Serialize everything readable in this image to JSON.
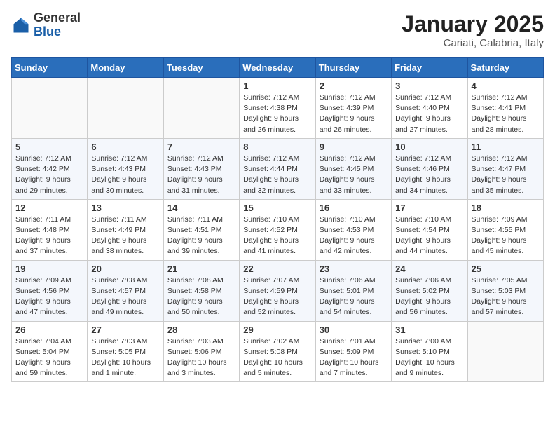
{
  "header": {
    "logo_general": "General",
    "logo_blue": "Blue",
    "month_year": "January 2025",
    "location": "Cariati, Calabria, Italy"
  },
  "weekdays": [
    "Sunday",
    "Monday",
    "Tuesday",
    "Wednesday",
    "Thursday",
    "Friday",
    "Saturday"
  ],
  "weeks": [
    [
      {
        "day": "",
        "info": ""
      },
      {
        "day": "",
        "info": ""
      },
      {
        "day": "",
        "info": ""
      },
      {
        "day": "1",
        "info": "Sunrise: 7:12 AM\nSunset: 4:38 PM\nDaylight: 9 hours and 26 minutes."
      },
      {
        "day": "2",
        "info": "Sunrise: 7:12 AM\nSunset: 4:39 PM\nDaylight: 9 hours and 26 minutes."
      },
      {
        "day": "3",
        "info": "Sunrise: 7:12 AM\nSunset: 4:40 PM\nDaylight: 9 hours and 27 minutes."
      },
      {
        "day": "4",
        "info": "Sunrise: 7:12 AM\nSunset: 4:41 PM\nDaylight: 9 hours and 28 minutes."
      }
    ],
    [
      {
        "day": "5",
        "info": "Sunrise: 7:12 AM\nSunset: 4:42 PM\nDaylight: 9 hours and 29 minutes."
      },
      {
        "day": "6",
        "info": "Sunrise: 7:12 AM\nSunset: 4:43 PM\nDaylight: 9 hours and 30 minutes."
      },
      {
        "day": "7",
        "info": "Sunrise: 7:12 AM\nSunset: 4:43 PM\nDaylight: 9 hours and 31 minutes."
      },
      {
        "day": "8",
        "info": "Sunrise: 7:12 AM\nSunset: 4:44 PM\nDaylight: 9 hours and 32 minutes."
      },
      {
        "day": "9",
        "info": "Sunrise: 7:12 AM\nSunset: 4:45 PM\nDaylight: 9 hours and 33 minutes."
      },
      {
        "day": "10",
        "info": "Sunrise: 7:12 AM\nSunset: 4:46 PM\nDaylight: 9 hours and 34 minutes."
      },
      {
        "day": "11",
        "info": "Sunrise: 7:12 AM\nSunset: 4:47 PM\nDaylight: 9 hours and 35 minutes."
      }
    ],
    [
      {
        "day": "12",
        "info": "Sunrise: 7:11 AM\nSunset: 4:48 PM\nDaylight: 9 hours and 37 minutes."
      },
      {
        "day": "13",
        "info": "Sunrise: 7:11 AM\nSunset: 4:49 PM\nDaylight: 9 hours and 38 minutes."
      },
      {
        "day": "14",
        "info": "Sunrise: 7:11 AM\nSunset: 4:51 PM\nDaylight: 9 hours and 39 minutes."
      },
      {
        "day": "15",
        "info": "Sunrise: 7:10 AM\nSunset: 4:52 PM\nDaylight: 9 hours and 41 minutes."
      },
      {
        "day": "16",
        "info": "Sunrise: 7:10 AM\nSunset: 4:53 PM\nDaylight: 9 hours and 42 minutes."
      },
      {
        "day": "17",
        "info": "Sunrise: 7:10 AM\nSunset: 4:54 PM\nDaylight: 9 hours and 44 minutes."
      },
      {
        "day": "18",
        "info": "Sunrise: 7:09 AM\nSunset: 4:55 PM\nDaylight: 9 hours and 45 minutes."
      }
    ],
    [
      {
        "day": "19",
        "info": "Sunrise: 7:09 AM\nSunset: 4:56 PM\nDaylight: 9 hours and 47 minutes."
      },
      {
        "day": "20",
        "info": "Sunrise: 7:08 AM\nSunset: 4:57 PM\nDaylight: 9 hours and 49 minutes."
      },
      {
        "day": "21",
        "info": "Sunrise: 7:08 AM\nSunset: 4:58 PM\nDaylight: 9 hours and 50 minutes."
      },
      {
        "day": "22",
        "info": "Sunrise: 7:07 AM\nSunset: 4:59 PM\nDaylight: 9 hours and 52 minutes."
      },
      {
        "day": "23",
        "info": "Sunrise: 7:06 AM\nSunset: 5:01 PM\nDaylight: 9 hours and 54 minutes."
      },
      {
        "day": "24",
        "info": "Sunrise: 7:06 AM\nSunset: 5:02 PM\nDaylight: 9 hours and 56 minutes."
      },
      {
        "day": "25",
        "info": "Sunrise: 7:05 AM\nSunset: 5:03 PM\nDaylight: 9 hours and 57 minutes."
      }
    ],
    [
      {
        "day": "26",
        "info": "Sunrise: 7:04 AM\nSunset: 5:04 PM\nDaylight: 9 hours and 59 minutes."
      },
      {
        "day": "27",
        "info": "Sunrise: 7:03 AM\nSunset: 5:05 PM\nDaylight: 10 hours and 1 minute."
      },
      {
        "day": "28",
        "info": "Sunrise: 7:03 AM\nSunset: 5:06 PM\nDaylight: 10 hours and 3 minutes."
      },
      {
        "day": "29",
        "info": "Sunrise: 7:02 AM\nSunset: 5:08 PM\nDaylight: 10 hours and 5 minutes."
      },
      {
        "day": "30",
        "info": "Sunrise: 7:01 AM\nSunset: 5:09 PM\nDaylight: 10 hours and 7 minutes."
      },
      {
        "day": "31",
        "info": "Sunrise: 7:00 AM\nSunset: 5:10 PM\nDaylight: 10 hours and 9 minutes."
      },
      {
        "day": "",
        "info": ""
      }
    ]
  ]
}
